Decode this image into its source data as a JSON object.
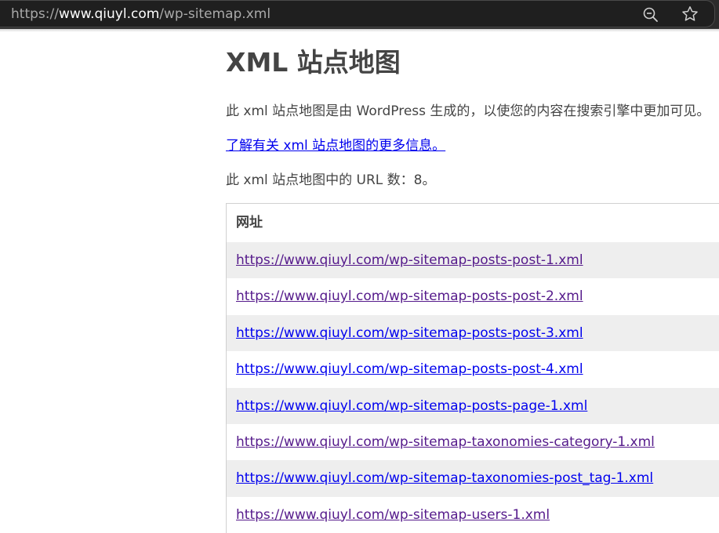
{
  "browser": {
    "url_protocol": "https://",
    "url_host": "www.qiuyl.com",
    "url_path": "/wp-sitemap.xml",
    "zoom_icon": "zoom-out-icon",
    "favorite_icon": "star-icon"
  },
  "page": {
    "title": "XML 站点地图",
    "intro": "此 xml 站点地图是由 WordPress 生成的，以使您的内容在搜索引擎中更加可见。",
    "learn_more": "了解有关 xml 站点地图的更多信息。",
    "count_text": "此 xml 站点地图中的 URL 数：8。"
  },
  "table": {
    "header": "网址",
    "rows": [
      {
        "url": "https://www.qiuyl.com/wp-sitemap-posts-post-1.xml",
        "visited": true
      },
      {
        "url": "https://www.qiuyl.com/wp-sitemap-posts-post-2.xml",
        "visited": true
      },
      {
        "url": "https://www.qiuyl.com/wp-sitemap-posts-post-3.xml",
        "visited": false
      },
      {
        "url": "https://www.qiuyl.com/wp-sitemap-posts-post-4.xml",
        "visited": false
      },
      {
        "url": "https://www.qiuyl.com/wp-sitemap-posts-page-1.xml",
        "visited": false
      },
      {
        "url": "https://www.qiuyl.com/wp-sitemap-taxonomies-category-1.xml",
        "visited": true
      },
      {
        "url": "https://www.qiuyl.com/wp-sitemap-taxonomies-post_tag-1.xml",
        "visited": false
      },
      {
        "url": "https://www.qiuyl.com/wp-sitemap-users-1.xml",
        "visited": true
      }
    ]
  },
  "colors": {
    "link": "#0000ee",
    "visited_link": "#551a8b",
    "row_shade": "#eeeeee",
    "text": "#444444"
  }
}
